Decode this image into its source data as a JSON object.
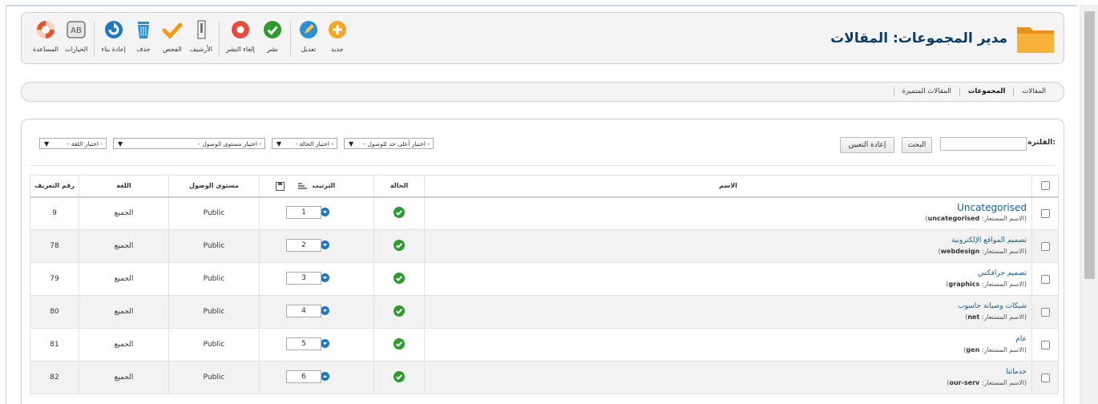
{
  "toolbar": {
    "title": "مدير المجموعات: المقالات",
    "buttons": [
      {
        "label": "المساعدة",
        "icon": "help-lifebuoy-icon",
        "color": "#e8542b"
      },
      {
        "label": "الخيارات",
        "icon": "options-icon",
        "color": "#5a5a5a"
      },
      {
        "label": "إعادة بناء",
        "icon": "rebuild-icon",
        "color": "#1f78c1"
      },
      {
        "label": "حذف",
        "icon": "trash-icon",
        "color": "#2a8fd4"
      },
      {
        "label": "الفحص",
        "icon": "check-icon",
        "color": "#f39c12"
      },
      {
        "label": "الأرشيف",
        "icon": "archive-icon",
        "color": "#777777"
      },
      {
        "label": "إلغاء النشر",
        "icon": "unpublish-icon",
        "color": "#e74c3c"
      },
      {
        "label": "نشر",
        "icon": "publish-icon",
        "color": "#2f9a2f"
      },
      {
        "label": "تعديل",
        "icon": "edit-icon",
        "color": "#2a8fd4"
      },
      {
        "label": "جديد",
        "icon": "new-icon",
        "color": "#f5a623"
      }
    ]
  },
  "subnav": {
    "items": [
      {
        "label": "المقالات",
        "active": false
      },
      {
        "label": "المجموعات",
        "active": true
      },
      {
        "label": "المقالات المتميزة",
        "active": false
      }
    ]
  },
  "filter": {
    "label": "الفلترة:",
    "search_value": "",
    "search_button": "البحث",
    "reset_button": "إعادة التعيين",
    "selects": {
      "max_access": "- اختيار أعلى حد للوصول -",
      "state": "- اختيار الحالة -",
      "access": "- اختيار مستوى الوصول -",
      "language": "- اختيار اللغة -"
    }
  },
  "table": {
    "headers": {
      "name": "الاسم",
      "status": "الحالة",
      "ordering": "الترتيب",
      "access": "مستوى الوصول",
      "language": "اللغة",
      "id": "رقم التعريف"
    },
    "alias_prefix": "(الاسم المستعار:",
    "rows": [
      {
        "title": "Uncategorised",
        "alias": "uncategorised",
        "order": "1",
        "access": "Public",
        "language": "الجميع",
        "id": "9"
      },
      {
        "title": "تصميم المواقع الإلكترونية",
        "alias": "webdesign",
        "order": "2",
        "access": "Public",
        "language": "الجميع",
        "id": "78"
      },
      {
        "title": "تصميم جرافكس",
        "alias": "graphics",
        "order": "3",
        "access": "Public",
        "language": "الجميع",
        "id": "79"
      },
      {
        "title": "شبكات وصيانة حاسوب",
        "alias": "net",
        "order": "4",
        "access": "Public",
        "language": "الجميع",
        "id": "80"
      },
      {
        "title": "عام",
        "alias": "gen",
        "order": "5",
        "access": "Public",
        "language": "الجميع",
        "id": "81"
      },
      {
        "title": "خدماتنا",
        "alias": "our-serv",
        "order": "6",
        "access": "Public",
        "language": "الجميع",
        "id": "82"
      }
    ]
  },
  "colors": {
    "title": "#0b3c66",
    "link": "#1a5b92",
    "status_published": "#2f9a2f",
    "order_arrow": "#1f78c1"
  }
}
